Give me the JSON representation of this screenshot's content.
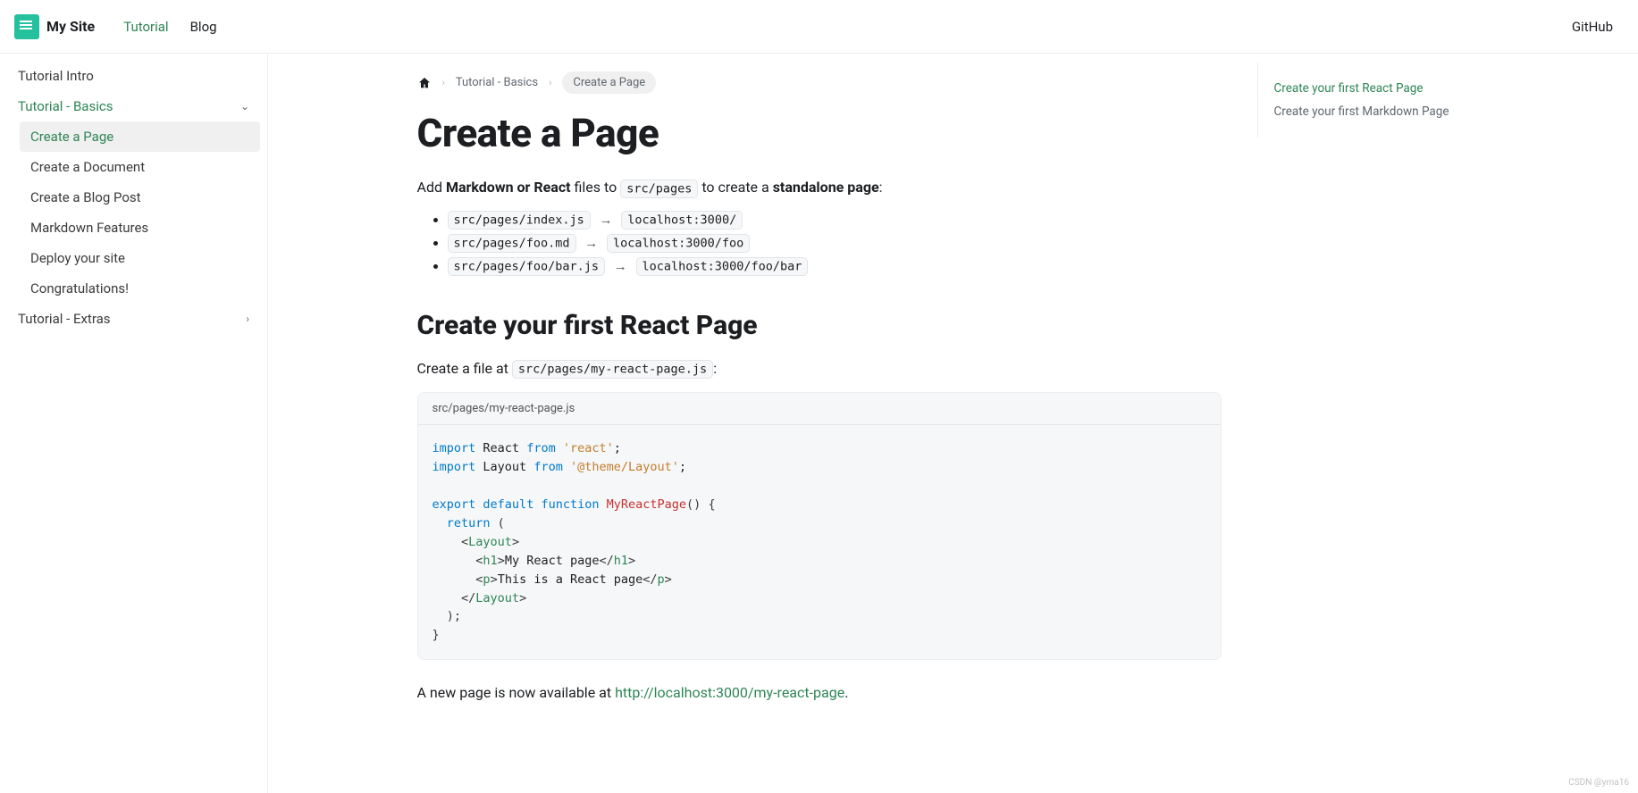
{
  "navbar": {
    "brand": "My Site",
    "links": [
      {
        "label": "Tutorial",
        "active": true
      },
      {
        "label": "Blog",
        "active": false
      }
    ],
    "right_link": "GitHub"
  },
  "sidebar": {
    "items": [
      {
        "label": "Tutorial Intro",
        "type": "item"
      },
      {
        "label": "Tutorial - Basics",
        "type": "category",
        "expanded": true,
        "active": true,
        "children": [
          {
            "label": "Create a Page",
            "active": true
          },
          {
            "label": "Create a Document"
          },
          {
            "label": "Create a Blog Post"
          },
          {
            "label": "Markdown Features"
          },
          {
            "label": "Deploy your site"
          },
          {
            "label": "Congratulations!"
          }
        ]
      },
      {
        "label": "Tutorial - Extras",
        "type": "category",
        "expanded": false
      }
    ]
  },
  "breadcrumb": {
    "items": [
      "Tutorial - Basics",
      "Create a Page"
    ]
  },
  "page": {
    "title": "Create a Page",
    "intro": {
      "pre": "Add ",
      "strong1": "Markdown or React",
      "mid": " files to ",
      "code": "src/pages",
      "post1": " to create a ",
      "strong2": "standalone page",
      "end": ":"
    },
    "mappings": [
      {
        "src": "src/pages/index.js",
        "dst": "localhost:3000/"
      },
      {
        "src": "src/pages/foo.md",
        "dst": "localhost:3000/foo"
      },
      {
        "src": "src/pages/foo/bar.js",
        "dst": "localhost:3000/foo/bar"
      }
    ],
    "h2_react": "Create your first React Page",
    "react_intro": {
      "pre": "Create a file at ",
      "code": "src/pages/my-react-page.js",
      "post": ":"
    },
    "codeblock": {
      "filename": "src/pages/my-react-page.js",
      "l1_kw1": "import",
      "l1_id": " React ",
      "l1_kw2": "from",
      "l1_str": "'react'",
      "l1_end": ";",
      "l2_kw1": "import",
      "l2_id": " Layout ",
      "l2_kw2": "from",
      "l2_str": "'@theme/Layout'",
      "l2_end": ";",
      "l3_kw1": "export",
      "l3_kw2": "default",
      "l3_kw3": "function",
      "l3_fn": "MyReactPage",
      "l3_par": "()",
      "l3_brace": " {",
      "l4_kw": "return",
      "l4_par": " (",
      "l5_open": "<",
      "l5_tag": "Layout",
      "l5_close": ">",
      "l6_a": "<",
      "l6_tag1": "h1",
      "l6_b": ">",
      "l6_txt": "My React page",
      "l6_c": "</",
      "l6_tag2": "h1",
      "l6_d": ">",
      "l7_a": "<",
      "l7_tag1": "p",
      "l7_b": ">",
      "l7_txt": "This is a React page",
      "l7_c": "</",
      "l7_tag2": "p",
      "l7_d": ">",
      "l8_open": "</",
      "l8_tag": "Layout",
      "l8_close": ">",
      "l9": ");",
      "l10": "}"
    },
    "outro": {
      "pre": "A new page is now available at ",
      "link": "http://localhost:3000/my-react-page",
      "post": "."
    }
  },
  "toc": {
    "items": [
      {
        "label": "Create your first React Page",
        "active": true
      },
      {
        "label": "Create your first Markdown Page",
        "active": false
      }
    ]
  },
  "watermark": "CSDN @yma16"
}
